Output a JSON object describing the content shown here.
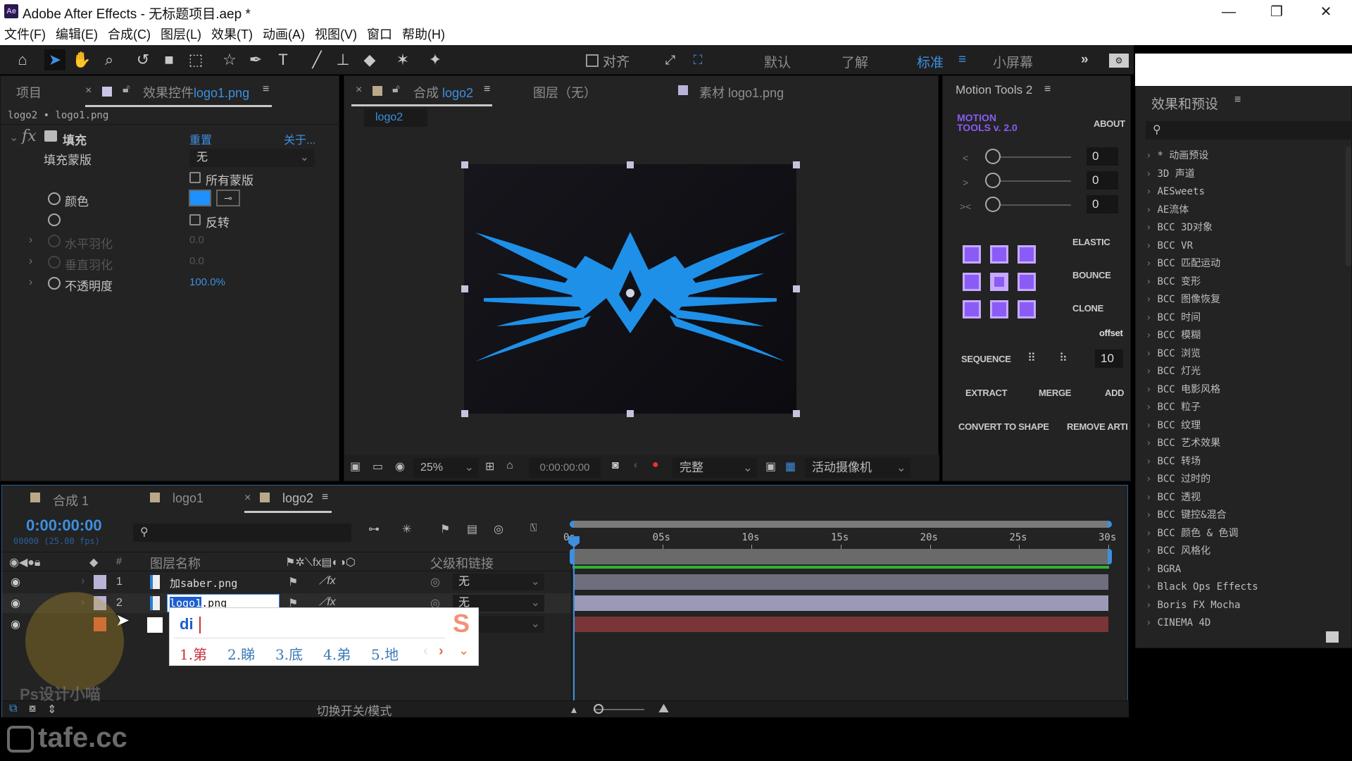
{
  "window": {
    "app_icon": "Ae",
    "title": "Adobe After Effects - 无标题项目.aep *",
    "minimize": "—",
    "restore": "❐",
    "close": "✕"
  },
  "menu": [
    "文件(F)",
    "编辑(E)",
    "合成(C)",
    "图层(L)",
    "效果(T)",
    "动画(A)",
    "视图(V)",
    "窗口",
    "帮助(H)"
  ],
  "toolbar": {
    "snap_label": "对齐",
    "workspaces": [
      "默认",
      "了解",
      "标准",
      "小屏幕"
    ],
    "active_workspace": "标准",
    "more": "»"
  },
  "project_panel": {
    "tab_project": "项目",
    "tab_effects": "效果控件",
    "effects_target": "logo1.png",
    "breadcrumb": "logo2 • logo1.png",
    "effect": {
      "name": "填充",
      "reset": "重置",
      "about": "关于...",
      "fill_mask_label": "填充蒙版",
      "fill_mask_value": "无",
      "all_masks": "所有蒙版",
      "color_label": "颜色",
      "color_value": "#1e90ff",
      "invert": "反转",
      "h_feather": "水平羽化",
      "h_feather_val": "0.0",
      "v_feather": "垂直羽化",
      "v_feather_val": "0.0",
      "opacity": "不透明度",
      "opacity_val": "100.0%"
    }
  },
  "comp_panel": {
    "tab_comp": "合成",
    "comp_name": "logo2",
    "tab_layer": "图层（无）",
    "tab_footage": "素材",
    "footage_name": "logo1.png",
    "crumb": "logo2",
    "zoom": "25%",
    "timecode": "0:00:00:00",
    "resolution": "完整",
    "camera": "活动摄像机"
  },
  "motion_tools": {
    "title": "Motion Tools 2",
    "brand_l1": "MOTION",
    "brand_l2": "TOOLS v. 2.0",
    "about": "ABOUT",
    "sliders": [
      {
        "icon": "<",
        "value": "0"
      },
      {
        "icon": ">",
        "value": "0"
      },
      {
        "icon": "><",
        "value": "0"
      }
    ],
    "elastic": "ELASTIC",
    "bounce": "BOUNCE",
    "clone": "CLONE",
    "offset": "offset",
    "sequence": "SEQUENCE",
    "sequence_value": "10",
    "extract": "EXTRACT",
    "merge": "MERGE",
    "add": "ADD",
    "convert": "CONVERT TO SHAPE",
    "remove": "REMOVE ARTI"
  },
  "effects_presets": {
    "title": "效果和预设",
    "search_placeholder": "",
    "items": [
      "* 动画预设",
      "3D 声道",
      "AESweets",
      "AE流体",
      "BCC 3D对象",
      "BCC VR",
      "BCC 匹配运动",
      "BCC 变形",
      "BCC 图像恢复",
      "BCC 时间",
      "BCC 模糊",
      "BCC 浏览",
      "BCC 灯光",
      "BCC 电影风格",
      "BCC 粒子",
      "BCC 纹理",
      "BCC 艺术效果",
      "BCC 转场",
      "BCC 过时的",
      "BCC 透视",
      "BCC 键控&混合",
      "BCC 颜色 & 色调",
      "BCC 风格化",
      "BGRA",
      "Black Ops Effects",
      "Boris FX Mocha",
      "CINEMA 4D"
    ]
  },
  "timeline": {
    "tabs": [
      {
        "label": "合成 1",
        "color": "#b9a98a"
      },
      {
        "label": "logo1",
        "color": "#b9a98a"
      },
      {
        "label": "logo2",
        "color": "#b9a98a",
        "active": true
      }
    ],
    "timecode": "0:00:00:00",
    "frames": "00000 (25.00 fps)",
    "col_num": "#",
    "col_name": "图层名称",
    "col_parent": "父级和链接",
    "layers": [
      {
        "num": "1",
        "name": "加saber.png",
        "parent": "无",
        "label_color": "#b8b4d8",
        "bar_color": "#6f6e7e"
      },
      {
        "num": "2",
        "name": "logo1.png",
        "editing_selected": "logo1",
        "parent": "无",
        "label_color": "#b8b4d8",
        "bar_color": "#9a9ab8"
      },
      {
        "num": "3",
        "name": "",
        "parent": "",
        "label_color": "#e05a3a",
        "bar_color": "#7a3538"
      }
    ],
    "ticks": [
      "0s",
      "05s",
      "10s",
      "15s",
      "20s",
      "25s",
      "30s"
    ],
    "toggle_modes": "切换开关/模式"
  },
  "ime": {
    "input": "di",
    "candidates": [
      "1.第",
      "2.睇",
      "3.底",
      "4.弟",
      "5.地"
    ]
  },
  "watermarks": {
    "site": "tafe.cc",
    "author": "Ps设计小喵"
  }
}
